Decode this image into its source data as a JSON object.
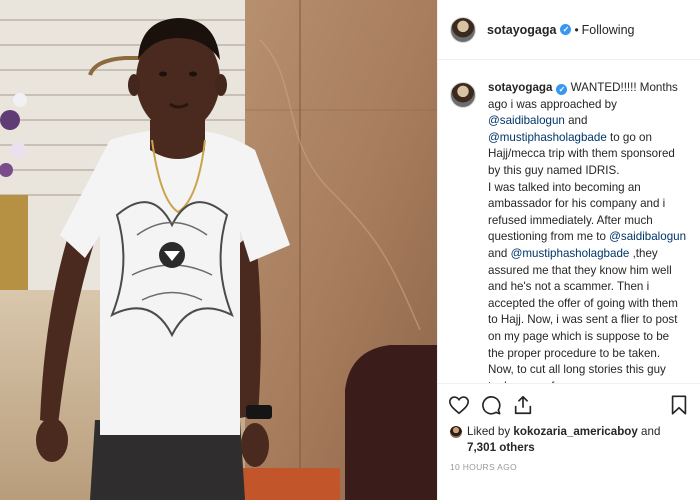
{
  "post": {
    "username": "sotayogaga",
    "verified": true,
    "separator": "•",
    "follow_status": "Following"
  },
  "caption": {
    "username": "sotayogaga",
    "segments": [
      {
        "t": "WANTED!!!!! Months ago i was approached by ",
        "m": false
      },
      {
        "t": "@saidibalogun",
        "m": true
      },
      {
        "t": " and ",
        "m": false
      },
      {
        "t": "@mustiphasholagbade",
        "m": true
      },
      {
        "t": " to go on Hajj/mecca trip with them sponsored by this guy named IDRIS.\nI was talked into becoming an ambassador for his company and i refused immediately. After much questioning from me to ",
        "m": false
      },
      {
        "t": "@saidibalogun",
        "m": true
      },
      {
        "t": " and ",
        "m": false
      },
      {
        "t": "@mustiphasholagbade",
        "m": true
      },
      {
        "t": " ,they assured me that they know him well and he's not a scammer. Then i accepted the offer of going with them to Hajj. Now, i was sent a flier to post on my page which is suppose to be the proper procedure to be taken. Now, to cut all long stories this guy took money from",
        "m": false
      }
    ]
  },
  "actions": {
    "icons": [
      "heart-icon",
      "comment-icon",
      "share-icon",
      "bookmark-icon"
    ]
  },
  "likes": {
    "prefix": "Liked by",
    "user": "kokozaria_americaboy",
    "joiner": "and",
    "others": "7,301 others"
  },
  "timestamp": "10 HOURS AGO",
  "colors": {
    "link": "#003569",
    "verified": "#3897f0",
    "muted": "#999999",
    "text": "#262626"
  }
}
